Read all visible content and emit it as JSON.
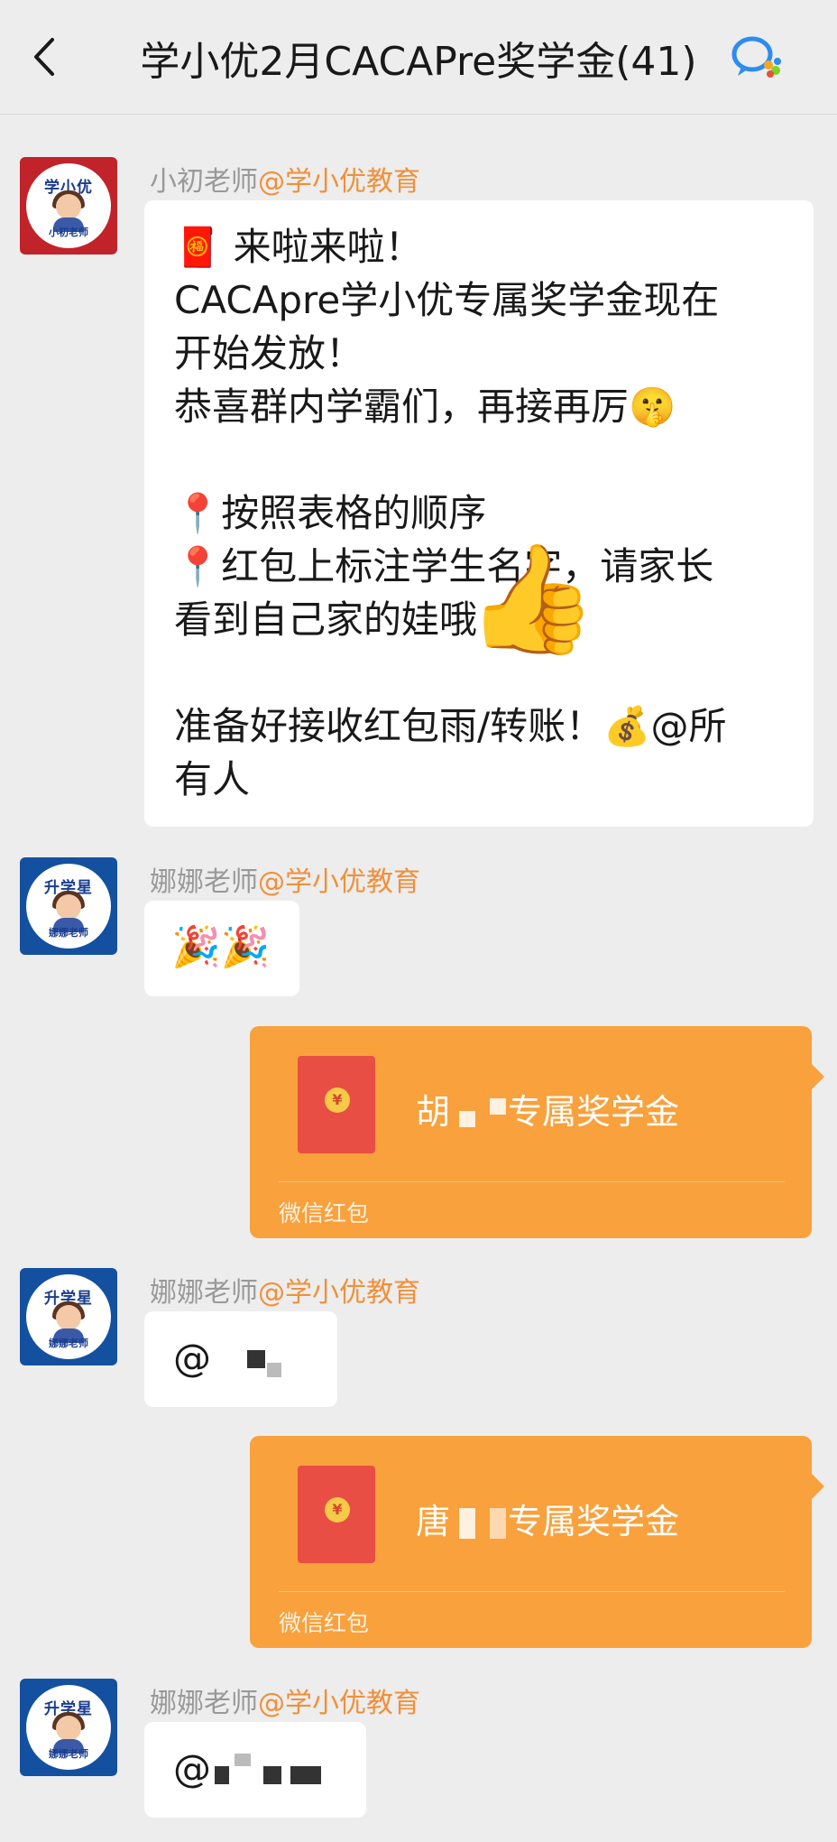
{
  "header": {
    "title": "学小优2月CACAPre奖学金(41)",
    "back_icon": "back-arrow-icon",
    "right_icon": "wecom-chat-icon"
  },
  "messages": [
    {
      "sender_name": "小初老师",
      "sender_org": "@学小优教育",
      "avatar_text_top": "学小优",
      "avatar_text_bottom": "小初老师",
      "lines": [
        "🧧 来啦来啦！",
        "CACApre学小优专属奖学金现在",
        "开始发放！",
        "恭喜群内学霸们，再接再厉🤫",
        "",
        "📍按照表格的顺序",
        "📍红包上标注学生名字，请家长",
        "看到自己家的娃哦",
        "",
        "准备好接收红包雨/转账！💰@所",
        "有人"
      ],
      "overlay_emoji": "👍"
    },
    {
      "sender_name": "娜娜老师",
      "sender_org": "@学小优教育",
      "avatar_text_top": "升学星",
      "avatar_text_bottom": "娜娜老师",
      "text": "🎉🎉"
    },
    {
      "type": "red_packet",
      "name_prefix": "胡",
      "title_suffix": "专属奖学金",
      "footer": "微信红包",
      "coin": "¥"
    },
    {
      "sender_name": "娜娜老师",
      "sender_org": "@学小优教育",
      "avatar_text_top": "升学星",
      "avatar_text_bottom": "娜娜老师",
      "text": "@"
    },
    {
      "type": "red_packet",
      "name_prefix": "唐",
      "title_suffix": "专属奖学金",
      "footer": "微信红包",
      "coin": "¥"
    },
    {
      "sender_name": "娜娜老师",
      "sender_org": "@学小优教育",
      "avatar_text_top": "升学星",
      "avatar_text_bottom": "娜娜老师",
      "text": "@"
    }
  ],
  "colors": {
    "background": "#ededed",
    "bubble": "#ffffff",
    "red_packet": "#f9a13c",
    "org_accent": "#f0903a",
    "sender_gray": "#999999"
  }
}
